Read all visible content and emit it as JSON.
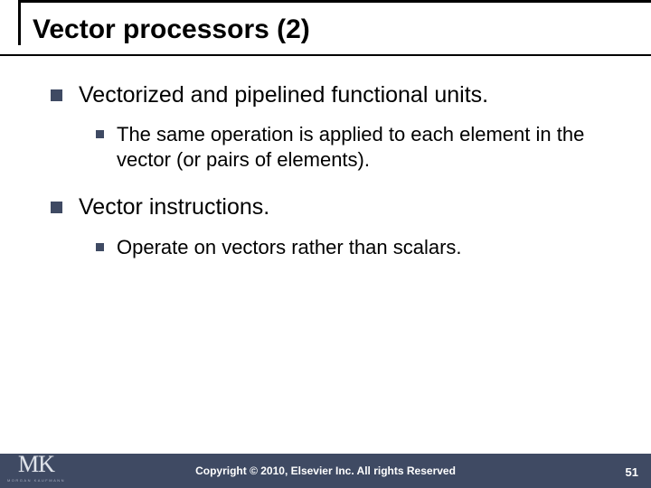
{
  "slide": {
    "title": "Vector processors (2)",
    "bullets": [
      {
        "text": "Vectorized and pipelined functional units.",
        "children": [
          {
            "text": "The same operation is applied to each element in the vector (or pairs of elements)."
          }
        ]
      },
      {
        "text": "Vector instructions.",
        "children": [
          {
            "text": "Operate on vectors rather than scalars."
          }
        ]
      }
    ]
  },
  "footer": {
    "copyright": "Copyright © 2010, Elsevier Inc. All rights Reserved",
    "page_number": "51",
    "logo_mark": "MK",
    "logo_sub": "MORGAN KAUFMANN"
  }
}
